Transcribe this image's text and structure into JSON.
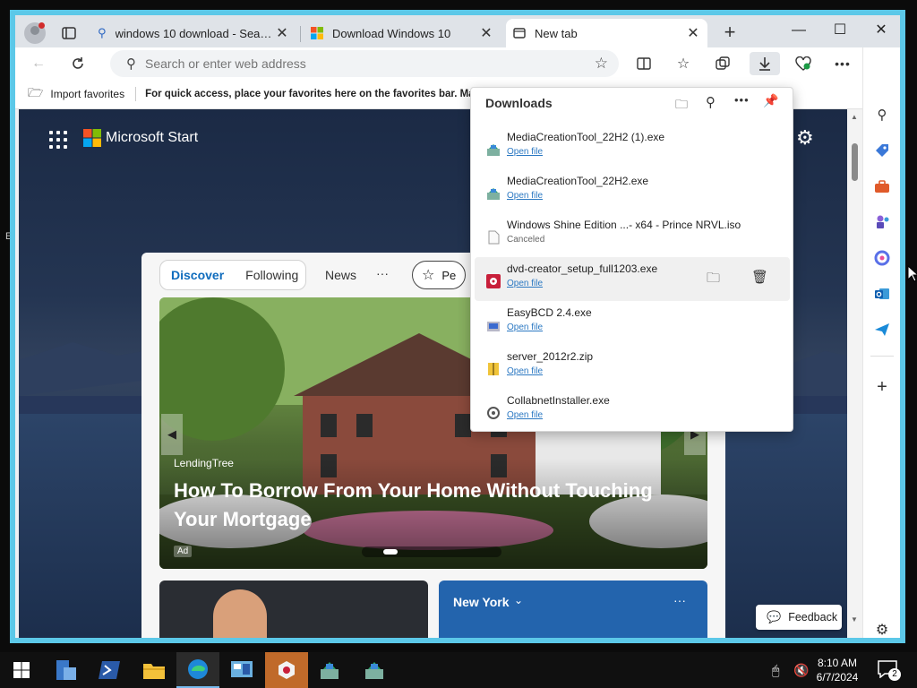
{
  "tabs": [
    {
      "title": "windows 10 download - Search",
      "icon": "search-icon"
    },
    {
      "title": "Download Windows 10",
      "icon": "windows-logo-icon"
    },
    {
      "title": "New tab",
      "icon": "newtab-icon",
      "active": true
    }
  ],
  "address": {
    "placeholder": "Search or enter web address"
  },
  "favorites": {
    "import_label": "Import favorites",
    "hint": "For quick access, place your favorites here on the favorites bar. Manage favorites now"
  },
  "downloads": {
    "title": "Downloads",
    "items": [
      {
        "name": "MediaCreationTool_22H2 (1).exe",
        "action": "Open file",
        "icon": "installer-icon"
      },
      {
        "name": "MediaCreationTool_22H2.exe",
        "action": "Open file",
        "icon": "installer-icon"
      },
      {
        "name": "Windows Shine Edition ...- x64 - Prince NRVL.iso",
        "status": "Canceled",
        "icon": "file-icon"
      },
      {
        "name": "dvd-creator_setup_full1203.exe",
        "action": "Open file",
        "icon": "app-icon"
      },
      {
        "name": "EasyBCD 2.4.exe",
        "action": "Open file",
        "icon": "installer-icon"
      },
      {
        "name": "server_2012r2.zip",
        "action": "Open file",
        "icon": "zip-icon"
      },
      {
        "name": "CollabnetInstaller.exe",
        "action": "Open file",
        "icon": "installer-icon"
      }
    ]
  },
  "ms_start": {
    "brand": "Microsoft Start"
  },
  "feed": {
    "tabs": [
      "Discover",
      "Following",
      "News"
    ],
    "more": "···",
    "partial_button": "Pe",
    "hero": {
      "source": "LendingTree",
      "headline": "How To Borrow From Your Home Without Touching Your Mortgage",
      "badge": "Ad"
    },
    "weather_city": "New York",
    "weather_more": "···"
  },
  "feedback_label": "Feedback",
  "clock": {
    "time": "8:10 AM",
    "date": "6/7/2024"
  },
  "notifications": {
    "count": "2"
  },
  "colors": {
    "accent": "#0f6cbd",
    "link": "#2b78c2",
    "frame": "#5cc8e8"
  }
}
